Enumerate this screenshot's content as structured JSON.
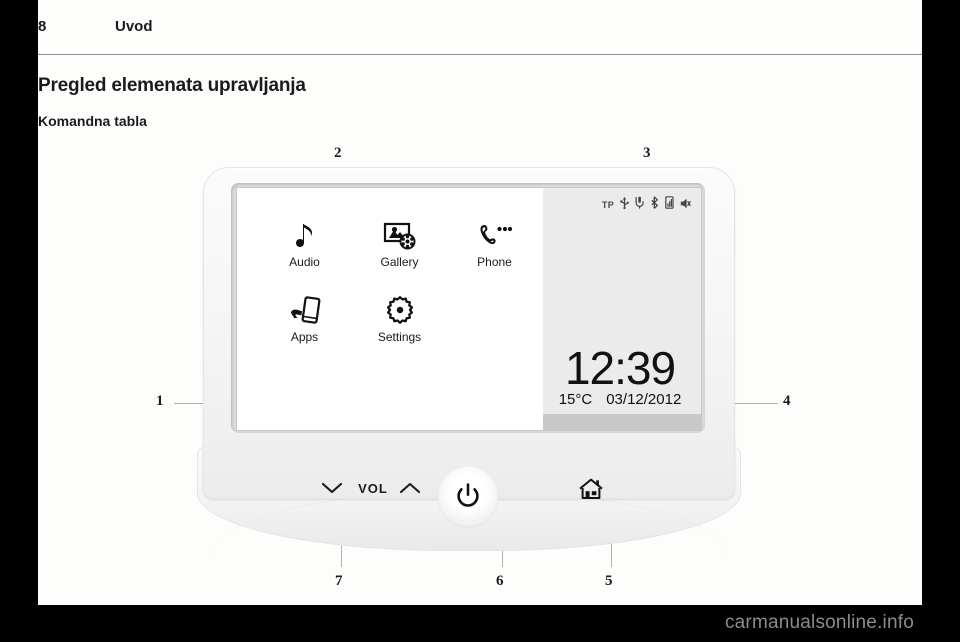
{
  "document": {
    "page_number": "8",
    "running_title": "Uvod",
    "section_title": "Pregled elemenata upravljanja",
    "sub_title": "Komandna tabla",
    "watermark": "carmanualsonline.info"
  },
  "figure": {
    "callouts": [
      {
        "id": "callout-1",
        "label": "1"
      },
      {
        "id": "callout-2",
        "label": "2"
      },
      {
        "id": "callout-3",
        "label": "3"
      },
      {
        "id": "callout-4",
        "label": "4"
      },
      {
        "id": "callout-5",
        "label": "5"
      },
      {
        "id": "callout-6",
        "label": "6"
      },
      {
        "id": "callout-7",
        "label": "7"
      }
    ]
  },
  "device": {
    "screen": {
      "menu": [
        [
          {
            "label": "Audio",
            "icon": "music-note-icon"
          },
          {
            "label": "Gallery",
            "icon": "gallery-icon"
          },
          {
            "label": "Phone",
            "icon": "phone-handset-icon"
          }
        ],
        [
          {
            "label": "Apps",
            "icon": "apps-hand-phone-icon"
          },
          {
            "label": "Settings",
            "icon": "gear-icon"
          }
        ]
      ],
      "status_bar": {
        "tp_label": "TP",
        "icons": [
          "usb-icon",
          "microphone-icon",
          "bluetooth-icon",
          "phone-signal-icon",
          "speaker-mute-icon"
        ]
      },
      "clock": {
        "time": "12:39",
        "temperature": "15°C",
        "date": "03/12/2012"
      }
    },
    "controls": {
      "volume_down": "volume-down-chevron-icon",
      "volume_label": "VOL",
      "volume_up": "volume-up-chevron-icon",
      "power": "power-icon",
      "home": "home-icon"
    }
  }
}
